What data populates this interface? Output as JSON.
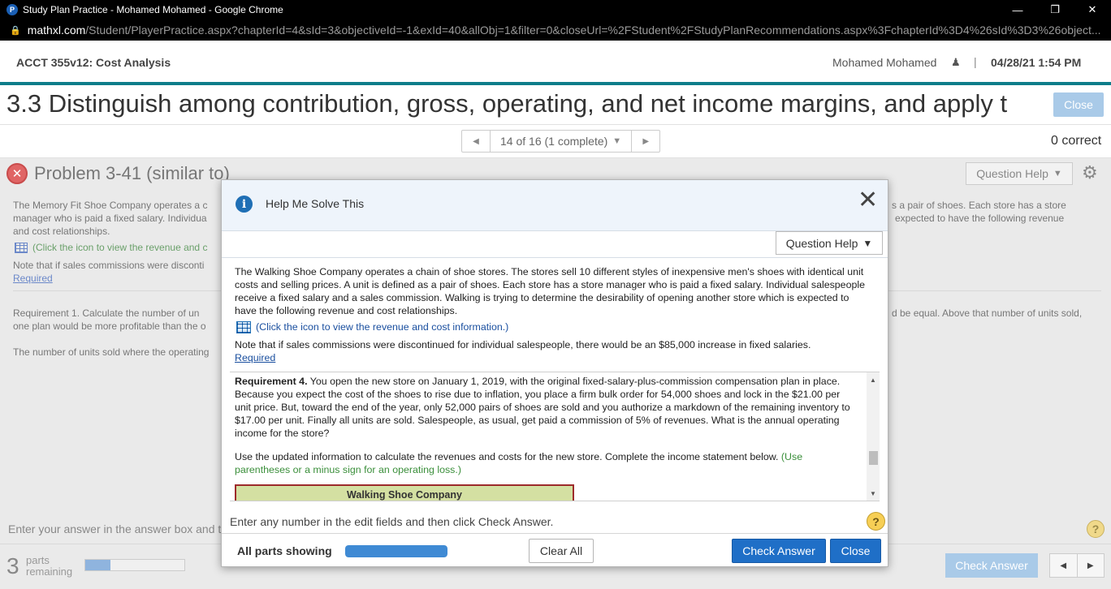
{
  "browser": {
    "tab_title": "Study Plan Practice - Mohamed Mohamed - Google Chrome",
    "favicon_letter": "P",
    "url_host": "mathxl.com",
    "url_path": "/Student/PlayerPractice.aspx?chapterId=4&sId=3&objectiveId=-1&exId=40&allObj=1&filter=0&closeUrl=%2FStudent%2FStudyPlanRecommendations.aspx%3FchapterId%3D4%26sId%3D3%26object..."
  },
  "header": {
    "course": "ACCT 355v12: Cost Analysis",
    "user": "Mohamed Mohamed",
    "separator": "|",
    "datetime": "04/28/21 1:54 PM"
  },
  "objective": {
    "title": "3.3 Distinguish among contribution, gross, operating, and net income margins, and apply t",
    "close_label": "Close"
  },
  "pager": {
    "position": "14 of 16 (1 complete)",
    "correct": "0 correct"
  },
  "background": {
    "problem_title": "Problem 3-41 (similar to)",
    "question_help": "Question Help",
    "line1_left": "The Memory Fit Shoe Company operates a c",
    "line1_right": "s a pair of shoes. Each store has a store",
    "line2_left": "manager who is paid a fixed salary. Individua",
    "line2_right": "expected to have the following revenue",
    "line3": "and cost relationships.",
    "table_link": "(Click the icon to view the revenue and c",
    "note": "Note that if sales commissions were disconti",
    "required": "Required",
    "req1_left": "Requirement 1.  Calculate the number of un",
    "req1_right": "d be equal. Above that number of units sold,",
    "req1_line2": "one plan would be more profitable than the o",
    "units_sold": "The number of units sold where the operating",
    "enter_answer": "Enter your answer in the answer box and t",
    "parts_count": "3",
    "parts_label1": "parts",
    "parts_label2": "remaining",
    "parts_progress": 0.25,
    "check_answer": "Check Answer",
    "help_glyph": "?"
  },
  "modal": {
    "title": "Help Me Solve This",
    "question_help": "Question Help",
    "intro": "The Walking Shoe Company operates a chain of shoe stores. The stores sell 10 different styles of inexpensive men's shoes with identical unit costs and selling prices. A unit is defined as a pair of shoes. Each store has a store manager who is paid a fixed salary. Individual salespeople receive a fixed salary and a sales commission. Walking is trying to determine the desirability of opening another store which is expected to have the following revenue and cost relationships.",
    "table_link": "(Click the icon to view the revenue and cost information.)",
    "note": "Note that if sales commissions were discontinued for individual salespeople, there would be an $85,000 increase in fixed salaries.",
    "required": "Required",
    "req4_label": "Requirement 4.",
    "req4_text": " You open the new store on January 1, 2019, with the original fixed-salary-plus-commission compensation plan in place. Because you expect the cost of the shoes to rise due to inflation, you place a firm bulk order for 54,000 shoes and lock in the $21.00 per unit price. But, toward the end of the year, only 52,000 pairs of shoes are sold and you authorize a markdown of the remaining inventory to $17.00 per unit. Finally all units are sold. Salespeople, as usual, get paid a commission of 5% of revenues. What is the annual operating income for the store?",
    "use_updated": "Use the updated information to calculate the revenues and costs for the new store. Complete the income statement below. ",
    "use_updated_hint": "(Use parentheses or a minus sign for an operating loss.)",
    "table_title": "Walking Shoe Company",
    "enter_hint": "Enter any number in the edit fields and then click Check Answer.",
    "help_glyph": "?",
    "all_parts": "All parts showing",
    "parts_progress": 1.0,
    "clear_all": "Clear All",
    "check_answer": "Check Answer",
    "close": "Close"
  },
  "colors": {
    "teal_rule": "#0e7d8a",
    "primary_button": "#1f6fc7",
    "disabled_button": "#a9cae8",
    "table_header_bg": "#d4e0a2",
    "table_border": "#9d2b2b"
  }
}
